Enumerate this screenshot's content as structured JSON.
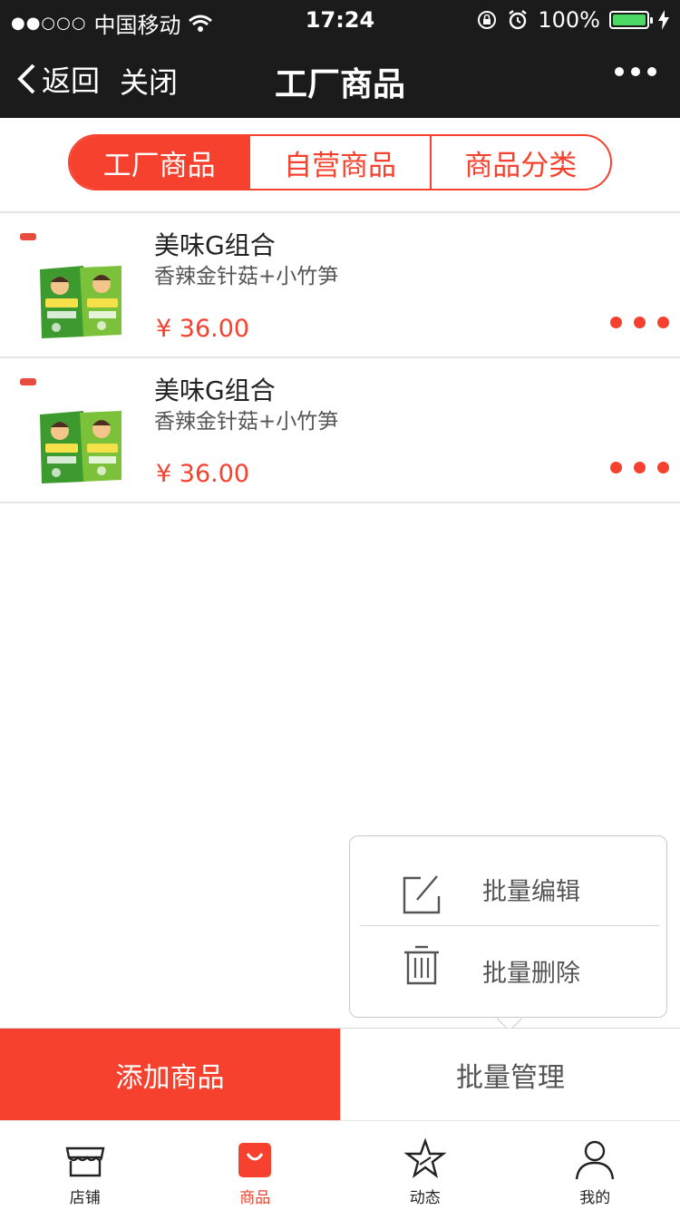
{
  "status_bar": {
    "carrier": "中国移动",
    "time": "17:24",
    "battery": "100%"
  },
  "nav": {
    "back_label": "返回",
    "close_label": "关闭",
    "title": "工厂商品"
  },
  "segments": [
    "工厂商品",
    "自营商品",
    "商品分类"
  ],
  "products": [
    {
      "name": "美味G组合",
      "desc": "香辣金针菇+小竹笋",
      "price": "¥ 36.00"
    },
    {
      "name": "美味G组合",
      "desc": "香辣金针菇+小竹笋",
      "price": "¥ 36.00"
    }
  ],
  "popup": {
    "edit_label": "批量编辑",
    "delete_label": "批量删除"
  },
  "actions": {
    "add_label": "添加商品",
    "batch_label": "批量管理"
  },
  "tabs": [
    {
      "label": "店铺",
      "icon": "store-icon"
    },
    {
      "label": "商品",
      "icon": "bag-icon"
    },
    {
      "label": "动态",
      "icon": "star-icon"
    },
    {
      "label": "我的",
      "icon": "user-icon"
    }
  ],
  "colors": {
    "accent": "#f5412d",
    "nav_bg": "#1b1b1b",
    "battery": "#4cd964"
  }
}
